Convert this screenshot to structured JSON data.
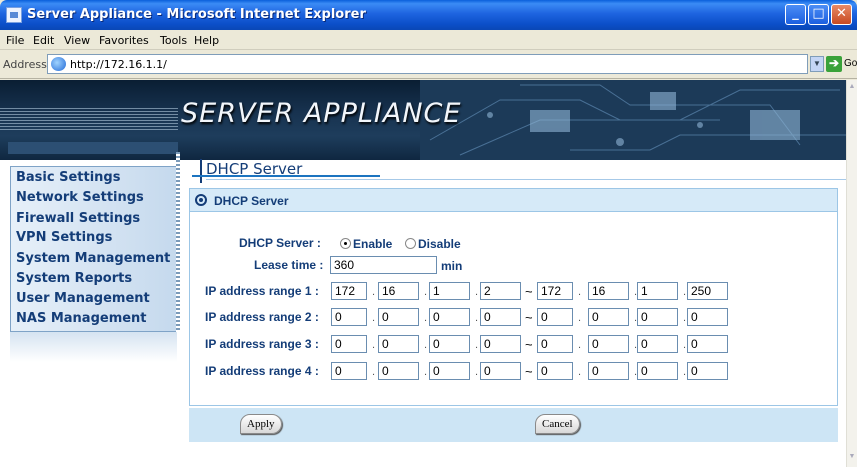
{
  "window": {
    "title": "Server Appliance - Microsoft Internet Explorer"
  },
  "menubar": {
    "items": [
      "File",
      "Edit",
      "View",
      "Favorites",
      "Tools",
      "Help"
    ]
  },
  "addressbar": {
    "label": "Address",
    "url": "http://172.16.1.1/",
    "go_label": "Go"
  },
  "banner": {
    "title": "SERVER APPLIANCE"
  },
  "nav": {
    "items": [
      "Basic Settings",
      "Network Settings",
      "Firewall Settings",
      "VPN Settings",
      "System Management",
      "System Reports",
      "User Management",
      "NAS Management"
    ]
  },
  "page": {
    "title": "DHCP Server"
  },
  "panel": {
    "title": "DHCP Server",
    "dhcp_label": "DHCP Server :",
    "enable_label": "Enable",
    "disable_label": "Disable",
    "selected": "Enable",
    "lease_label": "Lease time :",
    "lease_value": "360",
    "lease_unit": "min",
    "ranges": [
      {
        "label": "IP address range 1 :",
        "start": [
          "172",
          "16",
          "1",
          "2"
        ],
        "end": [
          "172",
          "16",
          "1",
          "250"
        ]
      },
      {
        "label": "IP address range 2 :",
        "start": [
          "0",
          "0",
          "0",
          "0"
        ],
        "end": [
          "0",
          "0",
          "0",
          "0"
        ]
      },
      {
        "label": "IP address range 3 :",
        "start": [
          "0",
          "0",
          "0",
          "0"
        ],
        "end": [
          "0",
          "0",
          "0",
          "0"
        ]
      },
      {
        "label": "IP address range 4 :",
        "start": [
          "0",
          "0",
          "0",
          "0"
        ],
        "end": [
          "0",
          "0",
          "0",
          "0"
        ]
      }
    ],
    "separator": ".",
    "range_separator": "~"
  },
  "buttons": {
    "apply": "Apply",
    "cancel": "Cancel"
  }
}
